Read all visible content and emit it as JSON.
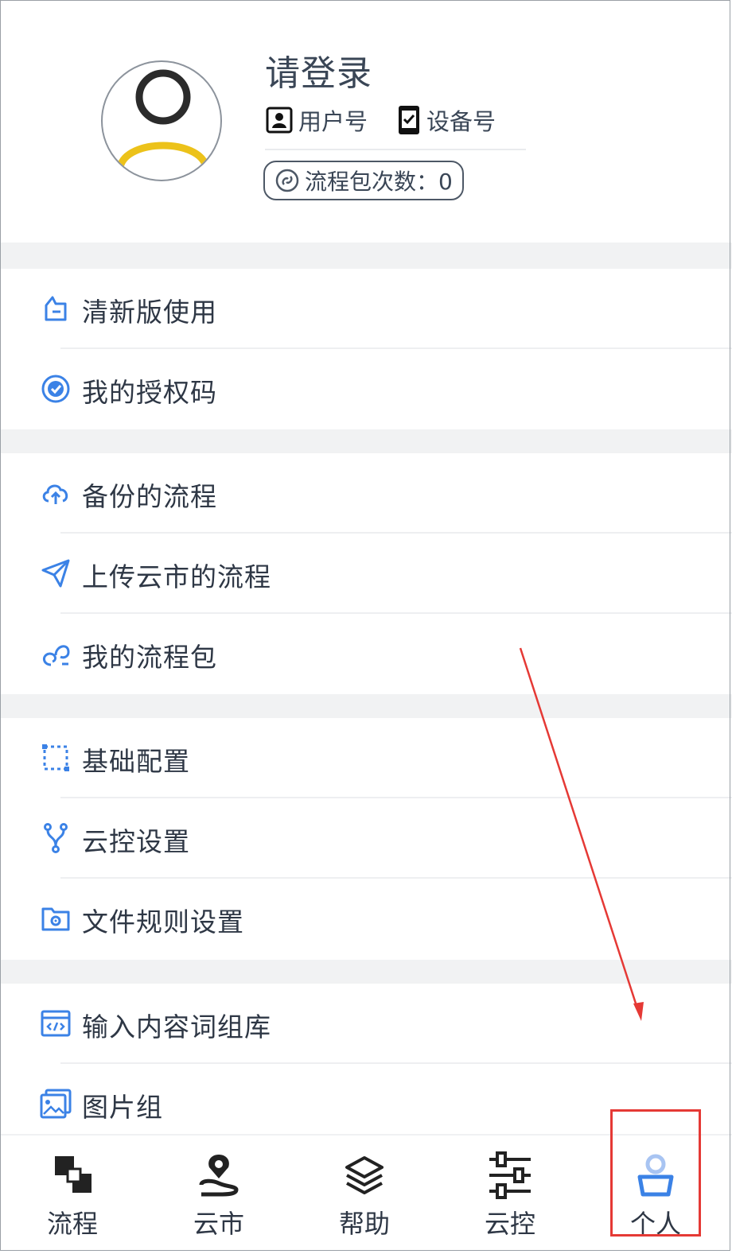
{
  "profile": {
    "title": "请登录",
    "user_label": "用户号",
    "device_label": "设备号",
    "package_count": "流程包次数：0"
  },
  "menu_sections": [
    {
      "items": [
        {
          "label": "清新版使用",
          "icon": "clean-version-icon"
        },
        {
          "label": "我的授权码",
          "icon": "auth-badge-icon"
        }
      ]
    },
    {
      "items": [
        {
          "label": "备份的流程",
          "icon": "cloud-backup-icon"
        },
        {
          "label": "上传云市的流程",
          "icon": "paper-plane-icon"
        },
        {
          "label": "我的流程包",
          "icon": "link-chain-icon"
        }
      ]
    },
    {
      "items": [
        {
          "label": "基础配置",
          "icon": "dashed-square-icon"
        },
        {
          "label": "云控设置",
          "icon": "branch-icon"
        },
        {
          "label": "文件规则设置",
          "icon": "folder-gear-icon"
        }
      ]
    },
    {
      "items": [
        {
          "label": "输入内容词组库",
          "icon": "code-window-icon"
        },
        {
          "label": "图片组",
          "icon": "image-stack-icon"
        }
      ]
    }
  ],
  "bottom_nav": {
    "tabs": [
      {
        "label": "流程",
        "icon": "flow-blocks-icon"
      },
      {
        "label": "云市",
        "icon": "map-pin-route-icon"
      },
      {
        "label": "帮助",
        "icon": "layers-icon"
      },
      {
        "label": "云控",
        "icon": "sliders-icon"
      },
      {
        "label": "个人",
        "icon": "person-icon"
      }
    ],
    "active_index": 4
  },
  "colors": {
    "accent": "#3b82e6",
    "text": "#2e3745",
    "annotation": "#e53935",
    "avatar_ring": "#ecc21a"
  }
}
